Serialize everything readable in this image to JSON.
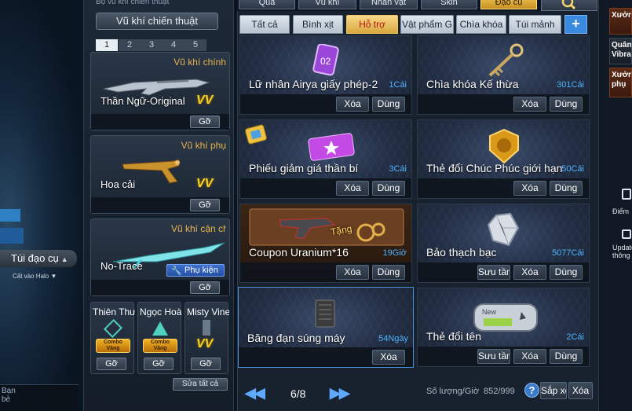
{
  "left": {
    "bag_label": "Túi đạo cụ",
    "halo_label": "Cất vào Halo",
    "chat_label": "Bạn bè"
  },
  "weapons": {
    "top_text": "Bộ vũ khí chiến thuật",
    "title": "Vũ khí chiến thuật",
    "pages": [
      "1",
      "2",
      "3",
      "4",
      "5"
    ],
    "active_page": "1",
    "cards": [
      {
        "name": "Thần Ngữ-Original",
        "category": "Vũ khí chính",
        "badge": "VV",
        "remove": "Gỡ"
      },
      {
        "name": "Hoa cải",
        "category": "Vũ khí phụ",
        "badge": "VV",
        "remove": "Gỡ"
      },
      {
        "name": "No-Trace",
        "category": "Vũ khí cận chiến",
        "accessory": "Phụ kiện",
        "remove": "Gỡ"
      }
    ],
    "small_cards": [
      {
        "name": "Thiên Thư",
        "badge": "Combo Vàng",
        "remove": "Gỡ"
      },
      {
        "name": "Ngọc Hoàng",
        "badge": "Combo Vàng",
        "remove": "Gỡ"
      },
      {
        "name": "Misty Vine",
        "badge": "VV",
        "remove": "Gỡ"
      }
    ],
    "repair_all": "Sửa tất cả"
  },
  "top_categories": [
    "Quà",
    "Vũ khí",
    "Nhân vật",
    "Skin",
    "Đạo cụ"
  ],
  "active_top_category": "Đạo cụ",
  "sub_tabs": [
    "Tất cả",
    "Bình xịt",
    "Hỗ trợ",
    "Vật phẩm G",
    "Chìa khóa",
    "Túi mảnh"
  ],
  "active_sub_tab": "Hỗ trợ",
  "items": [
    {
      "name": "Lữ nhân  Airya giấy phép-2",
      "qty": "1Cái",
      "actions": [
        "Xóa",
        "Dùng"
      ]
    },
    {
      "name": "Chìa khóa Kế thừa",
      "qty": "301Cái",
      "actions": [
        "Xóa",
        "Dùng"
      ]
    },
    {
      "name": "Phiếu giảm giá thần bí",
      "qty": "3Cái",
      "actions": [
        "Xóa",
        "Dùng"
      ]
    },
    {
      "name": "Thẻ đổi Chúc Phúc giới hạn",
      "qty": "50Cái",
      "actions": [
        "Xóa",
        "Dùng"
      ]
    },
    {
      "name": "Coupon Uranium*16",
      "qty": "19Giờ",
      "gift": "Tặng",
      "actions": [
        "Xóa",
        "Dùng"
      ]
    },
    {
      "name": "Bảo thạch bạc",
      "qty": "5077Cái",
      "actions": [
        "Sưu tầm",
        "Xóa",
        "Dùng"
      ]
    },
    {
      "name": "Băng đạn súng máy",
      "qty": "54Ngày",
      "actions": [
        "Xóa"
      ]
    },
    {
      "name": "Thẻ đổi tên",
      "qty": "2Cái",
      "actions": [
        "Sưu tầm",
        "Xóa",
        "Dùng"
      ]
    }
  ],
  "pager": {
    "prev": "◀◀",
    "text": "6/8",
    "next": "▶▶"
  },
  "footer": {
    "qty_label": "Số lượng/Giờ",
    "qty_value": "852/999",
    "help": "?",
    "sort": "Sắp xếp",
    "delete": "Xóa"
  },
  "right": {
    "tabs": [
      "Xưởng",
      "Quân Vibrant",
      "Xưởng phụ"
    ],
    "labels": [
      "Điểm",
      "Update thông"
    ]
  },
  "colors": {
    "accent": "#f1c85a",
    "qty": "#4fb3ff",
    "active_tab_text": "#b3150d",
    "weapon_category": "#e7b450"
  }
}
